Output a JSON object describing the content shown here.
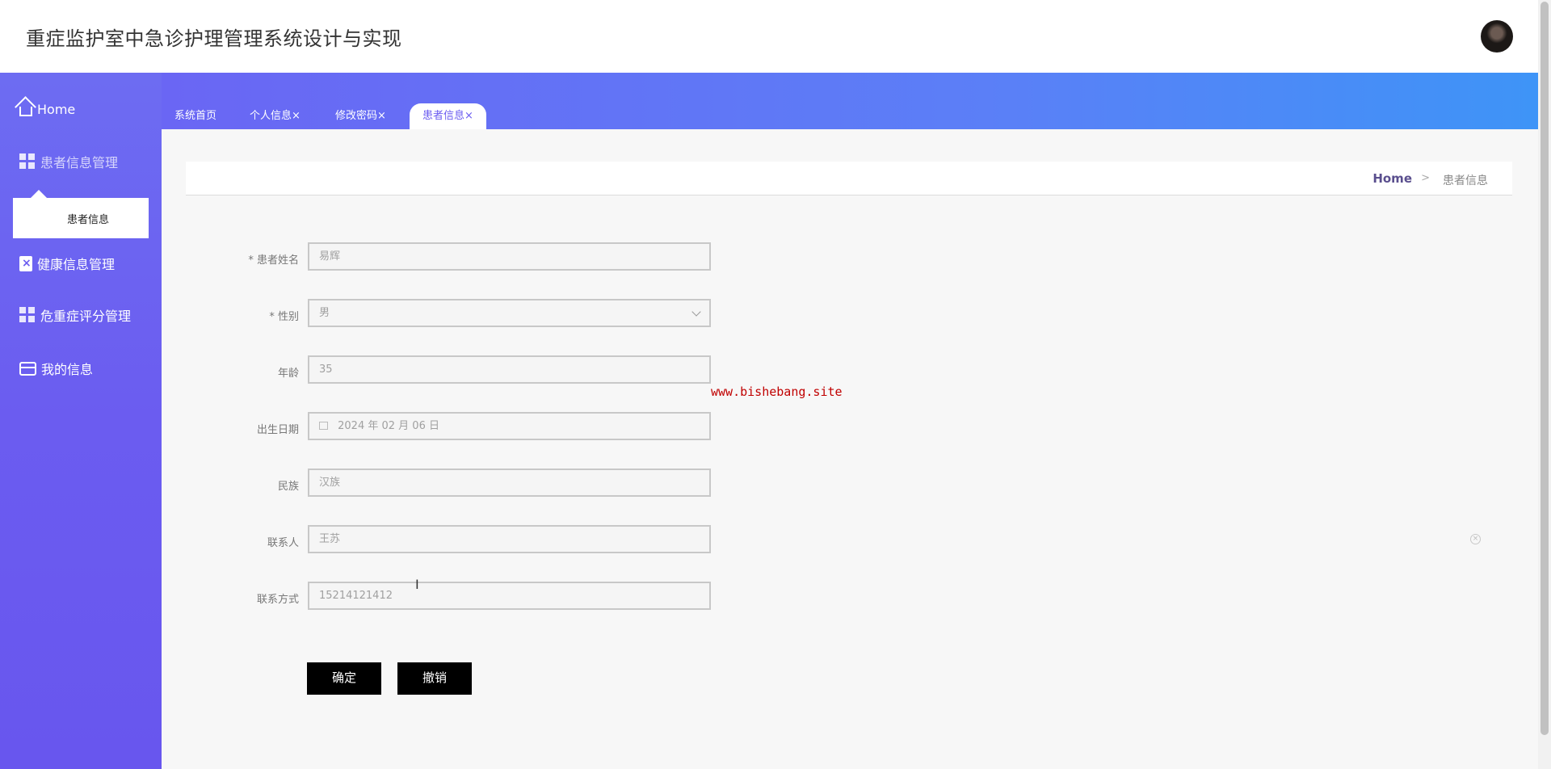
{
  "header": {
    "title": "重症监护室中急诊护理管理系统设计与实现"
  },
  "sidebar": {
    "items": [
      {
        "label": "Home",
        "icon": "home-icon"
      },
      {
        "label": "患者信息管理",
        "icon": "grid-icon"
      },
      {
        "label": "健康信息管理",
        "icon": "clipboard-icon"
      },
      {
        "label": "危重症评分管理",
        "icon": "grid-icon"
      },
      {
        "label": "我的信息",
        "icon": "card-icon"
      }
    ],
    "submenu": {
      "label": "患者信息"
    }
  },
  "tabs": [
    {
      "label": "系统首页"
    },
    {
      "label": "个人信息×"
    },
    {
      "label": "修改密码×"
    },
    {
      "label": "患者信息×"
    }
  ],
  "breadcrumb": {
    "home": "Home",
    "separator": ">",
    "current": "患者信息"
  },
  "form": {
    "fields": [
      {
        "label": "* 患者姓名",
        "value": "易辉"
      },
      {
        "label": "* 性别",
        "value": "男"
      },
      {
        "label": "年龄",
        "value": "35"
      },
      {
        "label": "出生日期",
        "value": "2024 年 02 月 06 日"
      },
      {
        "label": "民族",
        "value": "汉族"
      },
      {
        "label": "联系人",
        "value": "王苏"
      },
      {
        "label": "联系方式",
        "value": "15214121412"
      }
    ],
    "confirm_label": "确定",
    "cancel_label": "撤销"
  },
  "watermark": "www.bishebang.site",
  "colors": {
    "accent": "#6b5cf0",
    "sidebar": "#6b5cf0",
    "band_end": "#3e94f7"
  }
}
